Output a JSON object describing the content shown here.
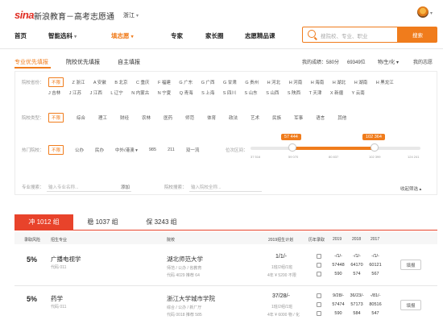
{
  "header": {
    "logo": "sina",
    "site_title": "新浪教育－高考志愿通",
    "region": "浙江"
  },
  "nav": {
    "items": [
      "首页",
      "智能选科",
      "填志愿",
      "专家",
      "家长圈",
      "志愿精品课"
    ],
    "active": "填志愿"
  },
  "search": {
    "placeholder": "搜院校、专业、职业",
    "button": "搜索"
  },
  "tabs": {
    "items": [
      "专业优先填报",
      "院校优先填报",
      "自主填报"
    ],
    "score_label": "我的成绩：580分",
    "rank_label": "69349位",
    "subjects_label": "物/生/化",
    "my_volunteer": "我的志愿"
  },
  "filters": {
    "province_label": "院校省份：",
    "provinces_row1": [
      "不限",
      "Z 浙江",
      "A 安徽",
      "B 北京",
      "C 重庆",
      "F 福建",
      "G 广东",
      "G 广西",
      "G 甘肃",
      "G 贵州",
      "H 河北",
      "H 河南",
      "H 海南",
      "H 湖北",
      "H 湖南",
      "H 黑龙江"
    ],
    "provinces_row2": [
      "J 吉林",
      "J 江苏",
      "J 江西",
      "L 辽宁",
      "N 内蒙古",
      "N 宁夏",
      "Q 青海",
      "S 上海",
      "S 四川",
      "S 山东",
      "S 山西",
      "S 陕西",
      "T 天津",
      "X 新疆",
      "Y 云南"
    ],
    "type_label": "院校类型：",
    "types": [
      "不限",
      "综合",
      "理工",
      "财经",
      "农林",
      "医药",
      "师范",
      "体育",
      "政法",
      "艺术",
      "民族",
      "军事",
      "语言",
      "其他"
    ],
    "level_label": "热门院校：",
    "levels": [
      "不限",
      "公办",
      "民办",
      "中外/港澳",
      "985",
      "211",
      "双一流"
    ],
    "rank_range_label": "位次区间：",
    "slider_low": "57 444",
    "slider_high": "102 364",
    "slider_ticks": [
      "37 516",
      "59 070",
      "80 837",
      "102 399",
      "124 241"
    ],
    "major_search_label": "专业搜索：",
    "major_search_placeholder": "输入专业名称...",
    "add_label": "添加",
    "school_search_label": "院校搜索：",
    "school_search_placeholder": "输入院校全称...",
    "collapse": "收起筛选"
  },
  "result_tabs": [
    "冲 1012 组",
    "稳 1037 组",
    "保 3243 组"
  ],
  "table": {
    "headers": [
      "录取风险",
      "招生专业",
      "院校",
      "2019招生计划",
      "历年录取",
      "2019",
      "2018",
      "2017"
    ],
    "rows": [
      {
        "risk": "5%",
        "major": "广播电视学",
        "major_code": "代码 011",
        "school": "湖北师范大学",
        "school_info": "师范 / 公办 / 省教育",
        "school_code": "代码 4029 推荐 64",
        "plan": "1/1/-",
        "plan_sub": "1班/2组/1班",
        "plan_fee": "4年 ¥ 5200 不限",
        "y2019": [
          "-/1/-",
          "57448",
          "590"
        ],
        "y2018": [
          "-/1/-",
          "64170",
          "574"
        ],
        "y2017": [
          "-/1/-",
          "60121",
          "567"
        ],
        "button": "填报"
      },
      {
        "risk": "5%",
        "major": "药学",
        "major_code": "代码 011",
        "school": "浙江大学城市学院",
        "school_info": "综合 / 公办 / 新厂厅",
        "school_code": "代码 0018 推荐 585",
        "plan": "37/28/-",
        "plan_sub": "1班/2组/1班",
        "plan_fee": "4年 ¥ 6000 物 / 化",
        "y2019": [
          "9/28/-",
          "57474",
          "590"
        ],
        "y2018": [
          "36/23/-",
          "57173",
          "584"
        ],
        "y2017": [
          "-/81/-",
          "80516",
          "547"
        ],
        "button": "填报"
      }
    ]
  },
  "colors": {
    "accent": "#f07c1c",
    "brand": "#e02e24",
    "tab_red": "#e8432b"
  }
}
